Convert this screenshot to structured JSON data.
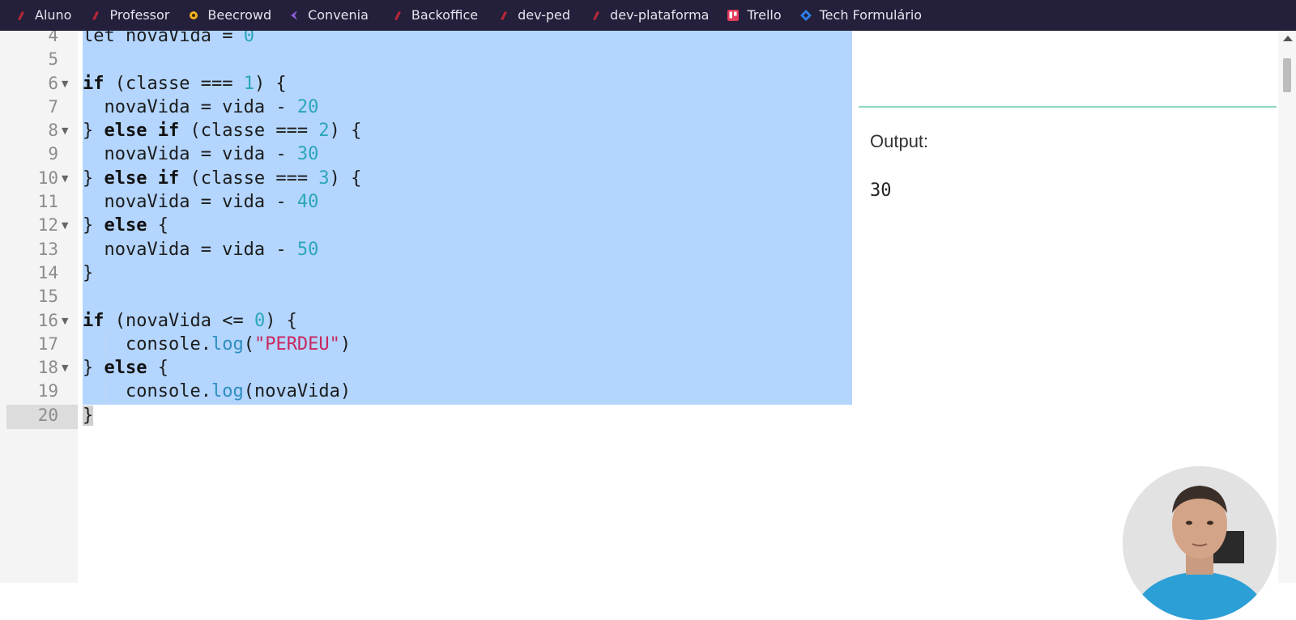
{
  "bookmarks": [
    {
      "label": "Aluno",
      "icon": "red-bookmark-icon"
    },
    {
      "label": "Professor",
      "icon": "red-bookmark-icon"
    },
    {
      "label": "Beecrowd",
      "icon": "beecrowd-logo-icon"
    },
    {
      "label": "Convenia",
      "icon": "convenia-logo-icon"
    },
    {
      "label": "Backoffice",
      "icon": "red-bookmark-icon"
    },
    {
      "label": "dev-ped",
      "icon": "red-bookmark-icon"
    },
    {
      "label": "dev-plataforma",
      "icon": "red-bookmark-icon"
    },
    {
      "label": "Trello",
      "icon": "trello-logo-icon"
    },
    {
      "label": "Tech Formulário",
      "icon": "jira-logo-icon"
    }
  ],
  "editor": {
    "lines": [
      {
        "num": "4",
        "fold": false
      },
      {
        "num": "5",
        "fold": false
      },
      {
        "num": "6",
        "fold": true
      },
      {
        "num": "7",
        "fold": false
      },
      {
        "num": "8",
        "fold": true
      },
      {
        "num": "9",
        "fold": false
      },
      {
        "num": "10",
        "fold": true
      },
      {
        "num": "11",
        "fold": false
      },
      {
        "num": "12",
        "fold": true
      },
      {
        "num": "13",
        "fold": false
      },
      {
        "num": "14",
        "fold": false
      },
      {
        "num": "15",
        "fold": false
      },
      {
        "num": "16",
        "fold": true
      },
      {
        "num": "17",
        "fold": false
      },
      {
        "num": "18",
        "fold": true
      },
      {
        "num": "19",
        "fold": false
      },
      {
        "num": "20",
        "fold": false
      }
    ],
    "code": {
      "l4_kw": "let",
      "l4_rest": " novaVida = ",
      "l4_num": "0",
      "l6_kw": "if",
      "l6_a": " (classe === ",
      "l6_num": "1",
      "l6_b": ") {",
      "l7_a": "  novaVida = vida - ",
      "l7_num": "20",
      "l8_a": "} ",
      "l8_kw": "else if",
      "l8_b": " (classe === ",
      "l8_num": "2",
      "l8_c": ") {",
      "l9_a": "  novaVida = vida - ",
      "l9_num": "30",
      "l10_a": "} ",
      "l10_kw": "else if",
      "l10_b": " (classe === ",
      "l10_num": "3",
      "l10_c": ") {",
      "l11_a": "  novaVida = vida - ",
      "l11_num": "40",
      "l12_a": "} ",
      "l12_kw": "else",
      "l12_b": " {",
      "l13_a": "  novaVida = vida - ",
      "l13_num": "50",
      "l14_a": "}",
      "l16_kw": "if",
      "l16_a": " (novaVida <= ",
      "l16_num": "0",
      "l16_b": ") {",
      "l17_a": "    console.",
      "l17_fn": "log",
      "l17_b": "(",
      "l17_str": "\"PERDEU\"",
      "l17_c": ")",
      "l18_a": "} ",
      "l18_kw": "else",
      "l18_b": " {",
      "l19_a": "    console.",
      "l19_fn": "log",
      "l19_b": "(novaVida)",
      "l20_a": "}"
    }
  },
  "output": {
    "label": "Output:",
    "value": "30"
  },
  "colors": {
    "bookmark_bar": "#241f3a",
    "selection": "#b3d5fe",
    "number": "#2ba7b8",
    "string": "#c8275e",
    "divider": "#8fd8bb"
  }
}
